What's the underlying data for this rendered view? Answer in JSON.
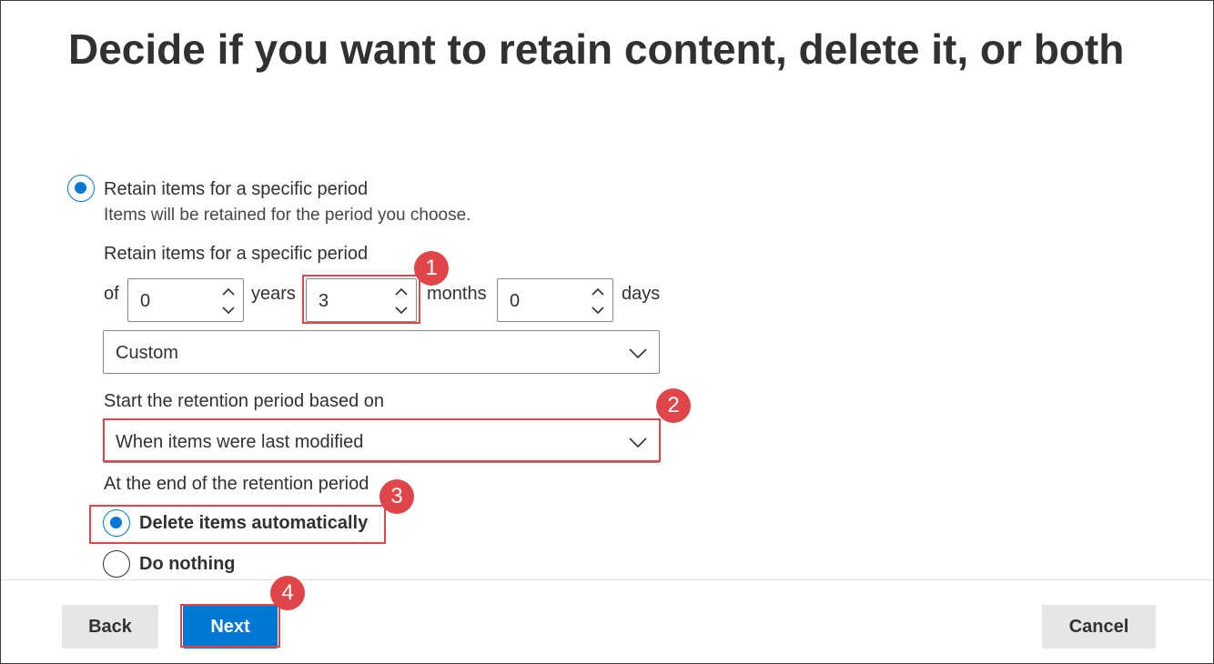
{
  "page": {
    "title": "Decide if you want to retain content, delete it, or both"
  },
  "retain_option": {
    "label": "Retain items for a specific period",
    "description": "Items will be retained for the period you choose.",
    "selected": true
  },
  "period": {
    "heading": "Retain items for a specific period",
    "of_label": "of",
    "years": {
      "value": "0",
      "unit": "years"
    },
    "months": {
      "value": "3",
      "unit": "months"
    },
    "days": {
      "value": "0",
      "unit": "days"
    },
    "preset": "Custom"
  },
  "start_based_on": {
    "heading": "Start the retention period based on",
    "value": "When items were last modified"
  },
  "end_action": {
    "heading": "At the end of the retention period",
    "options": [
      {
        "label": "Delete items automatically",
        "selected": true
      },
      {
        "label": "Do nothing",
        "selected": false
      }
    ]
  },
  "footer": {
    "back_label": "Back",
    "next_label": "Next",
    "cancel_label": "Cancel"
  },
  "annotations": {
    "step1": "1",
    "step2": "2",
    "step3": "3",
    "step4": "4",
    "highlight_color": "#e0454a"
  },
  "colors": {
    "accent": "#0078d4",
    "text": "#323130"
  },
  "icons": {
    "spinner_up": "chevron-up-icon",
    "spinner_down": "chevron-down-icon",
    "dropdown": "chevron-down-icon"
  }
}
